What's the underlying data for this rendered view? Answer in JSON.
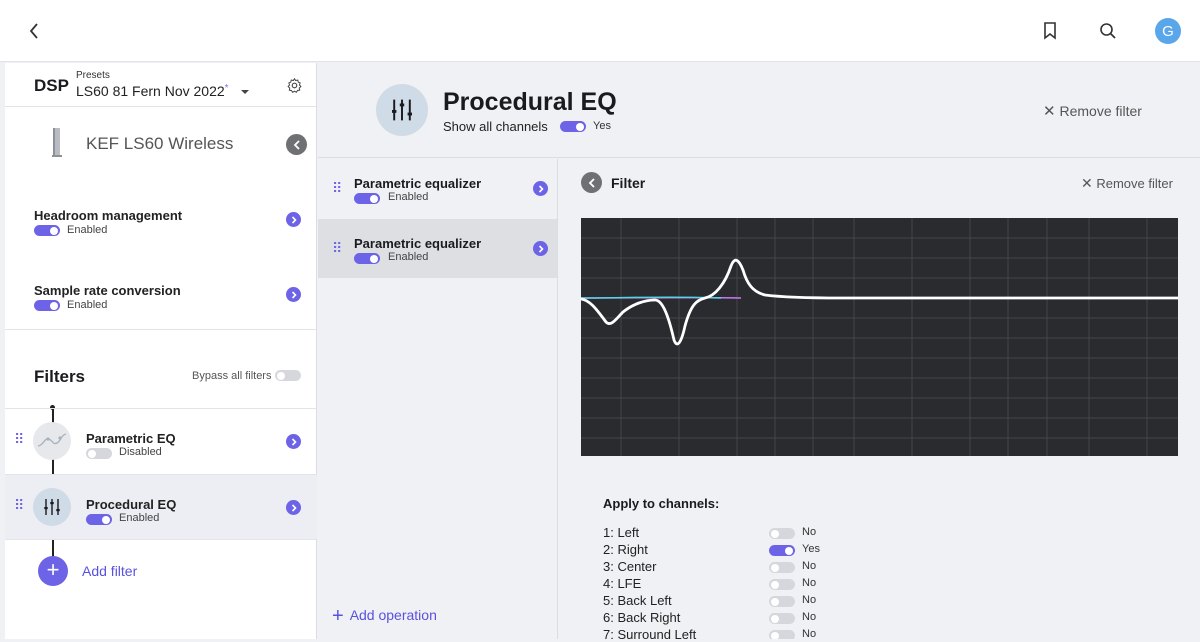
{
  "topbar": {
    "avatar_letter": "G"
  },
  "sidebar": {
    "dsp_title": "DSP",
    "presets_label": "Presets",
    "preset_name": "LS60 81 Fern Nov 2022",
    "preset_modified_mark": "*",
    "speaker_name": "KEF LS60 Wireless",
    "settings": [
      {
        "title": "Headroom management",
        "status": "Enabled"
      },
      {
        "title": "Sample rate conversion",
        "status": "Enabled"
      }
    ],
    "filters_title": "Filters",
    "bypass_label": "Bypass all filters",
    "filters": [
      {
        "title": "Parametric EQ",
        "status": "Disabled"
      },
      {
        "title": "Procedural EQ",
        "status": "Enabled"
      }
    ],
    "add_filter_label": "Add filter"
  },
  "header": {
    "title": "Procedural EQ",
    "show_all_label": "Show all channels",
    "show_all_value": "Yes",
    "remove_label": "Remove filter"
  },
  "operations": {
    "items": [
      {
        "title": "Parametric equalizer",
        "status": "Enabled"
      },
      {
        "title": "Parametric equalizer",
        "status": "Enabled"
      }
    ],
    "add_label": "Add operation"
  },
  "detail": {
    "title": "Filter",
    "remove_label": "Remove filter",
    "apply_title": "Apply to channels:",
    "channels": [
      {
        "label": "1: Left",
        "value": "No"
      },
      {
        "label": "2: Right",
        "value": "Yes"
      },
      {
        "label": "3: Center",
        "value": "No"
      },
      {
        "label": "4: LFE",
        "value": "No"
      },
      {
        "label": "5: Back Left",
        "value": "No"
      },
      {
        "label": "6: Back Right",
        "value": "No"
      },
      {
        "label": "7: Surround Left",
        "value": "No"
      }
    ]
  },
  "colors": {
    "accent": "#6d63e6",
    "graph_bg": "#2a2b2e",
    "curve": "#ffffff"
  }
}
